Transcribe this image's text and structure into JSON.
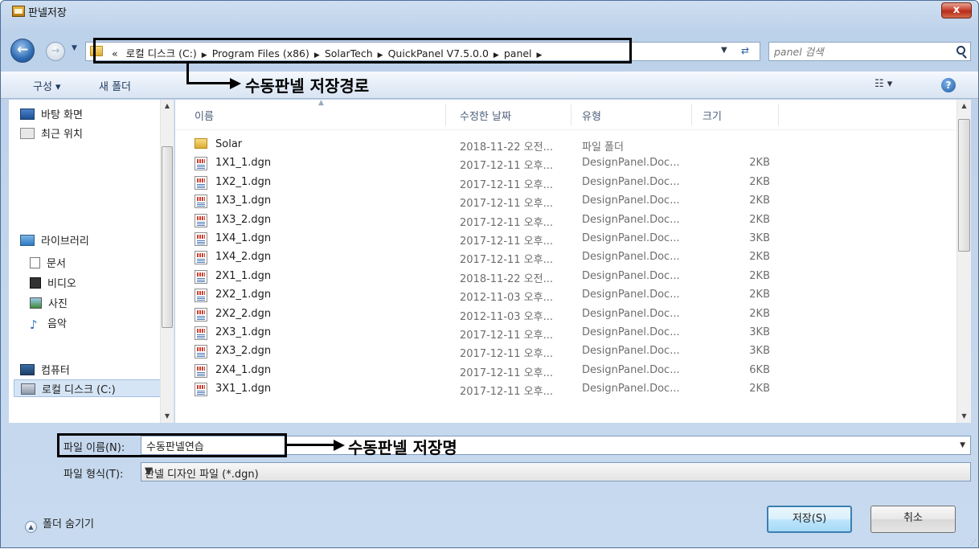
{
  "window": {
    "title": "판넬저장",
    "close_label": "x"
  },
  "address": {
    "breadcrumbs": [
      "«",
      "로컬 디스크 (C:)",
      "Program Files (x86)",
      "SolarTech",
      "QuickPanel V7.5.0.0",
      "panel"
    ]
  },
  "search": {
    "placeholder": "panel 검색"
  },
  "toolbar": {
    "organize_label": "구성 ▾",
    "new_folder_label": "새 폴더"
  },
  "annotations": {
    "path_callout": "수동판넬 저장경로",
    "name_callout": "수동판넬 저장명"
  },
  "nav": {
    "items": [
      {
        "label": "바탕 화면",
        "icon": "desktop-icon"
      },
      {
        "label": "최근 위치",
        "icon": "recent-places-icon"
      },
      {
        "label": "라이브러리",
        "icon": "library-icon"
      },
      {
        "label": "문서",
        "icon": "document-icon"
      },
      {
        "label": "비디오",
        "icon": "video-icon"
      },
      {
        "label": "사진",
        "icon": "picture-icon"
      },
      {
        "label": "음악",
        "icon": "music-icon"
      },
      {
        "label": "컴퓨터",
        "icon": "computer-icon"
      },
      {
        "label": "로컬 디스크 (C:)",
        "icon": "drive-icon"
      }
    ]
  },
  "file_list": {
    "columns": [
      "이름",
      "수정한 날짜",
      "유형",
      "크기"
    ],
    "rows": [
      {
        "name": "Solar",
        "date": "2018-11-22 오전...",
        "type": "파일 폴더",
        "size": "",
        "icon": "folder-icon"
      },
      {
        "name": "1X1_1.dgn",
        "date": "2017-12-11 오후...",
        "type": "DesignPanel.Doc...",
        "size": "2KB",
        "icon": "dgn-file-icon"
      },
      {
        "name": "1X2_1.dgn",
        "date": "2017-12-11 오후...",
        "type": "DesignPanel.Doc...",
        "size": "2KB",
        "icon": "dgn-file-icon"
      },
      {
        "name": "1X3_1.dgn",
        "date": "2017-12-11 오후...",
        "type": "DesignPanel.Doc...",
        "size": "2KB",
        "icon": "dgn-file-icon"
      },
      {
        "name": "1X3_2.dgn",
        "date": "2017-12-11 오후...",
        "type": "DesignPanel.Doc...",
        "size": "2KB",
        "icon": "dgn-file-icon"
      },
      {
        "name": "1X4_1.dgn",
        "date": "2017-12-11 오후...",
        "type": "DesignPanel.Doc...",
        "size": "3KB",
        "icon": "dgn-file-icon"
      },
      {
        "name": "1X4_2.dgn",
        "date": "2017-12-11 오후...",
        "type": "DesignPanel.Doc...",
        "size": "2KB",
        "icon": "dgn-file-icon"
      },
      {
        "name": "2X1_1.dgn",
        "date": "2018-11-22 오전...",
        "type": "DesignPanel.Doc...",
        "size": "2KB",
        "icon": "dgn-file-icon"
      },
      {
        "name": "2X2_1.dgn",
        "date": "2012-11-03 오후...",
        "type": "DesignPanel.Doc...",
        "size": "2KB",
        "icon": "dgn-file-icon"
      },
      {
        "name": "2X2_2.dgn",
        "date": "2012-11-03 오후...",
        "type": "DesignPanel.Doc...",
        "size": "2KB",
        "icon": "dgn-file-icon"
      },
      {
        "name": "2X3_1.dgn",
        "date": "2017-12-11 오후...",
        "type": "DesignPanel.Doc...",
        "size": "3KB",
        "icon": "dgn-file-icon"
      },
      {
        "name": "2X3_2.dgn",
        "date": "2017-12-11 오후...",
        "type": "DesignPanel.Doc...",
        "size": "3KB",
        "icon": "dgn-file-icon"
      },
      {
        "name": "2X4_1.dgn",
        "date": "2017-12-11 오후...",
        "type": "DesignPanel.Doc...",
        "size": "6KB",
        "icon": "dgn-file-icon"
      },
      {
        "name": "3X1_1.dgn",
        "date": "2017-12-11 오후...",
        "type": "DesignPanel.Doc...",
        "size": "2KB",
        "icon": "dgn-file-icon"
      }
    ]
  },
  "save_form": {
    "file_name_label": "파일 이름(N):",
    "file_name_value": "수동판넬연습",
    "file_type_label": "파일 형식(T):",
    "file_type_value": "판넬 디자인 파일 (*.dgn)"
  },
  "footer": {
    "hide_folders_label": "폴더 숨기기",
    "save_label": "저장(S)",
    "cancel_label": "취소"
  }
}
